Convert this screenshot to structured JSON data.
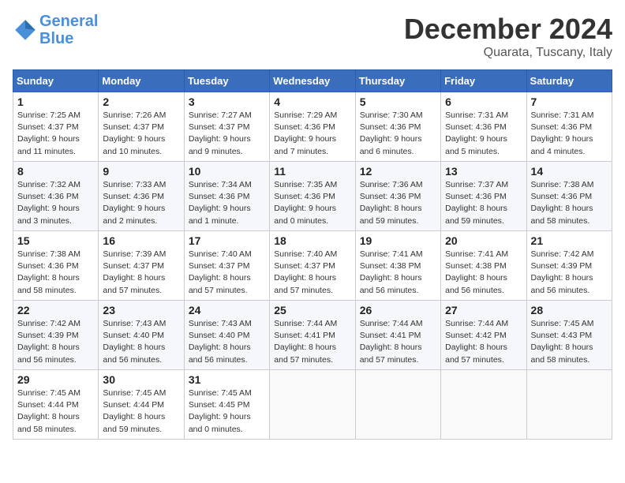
{
  "header": {
    "logo_line1": "General",
    "logo_line2": "Blue",
    "month_title": "December 2024",
    "location": "Quarata, Tuscany, Italy"
  },
  "weekdays": [
    "Sunday",
    "Monday",
    "Tuesday",
    "Wednesday",
    "Thursday",
    "Friday",
    "Saturday"
  ],
  "weeks": [
    [
      {
        "day": "1",
        "sunrise": "7:25 AM",
        "sunset": "4:37 PM",
        "daylight": "9 hours and 11 minutes."
      },
      {
        "day": "2",
        "sunrise": "7:26 AM",
        "sunset": "4:37 PM",
        "daylight": "9 hours and 10 minutes."
      },
      {
        "day": "3",
        "sunrise": "7:27 AM",
        "sunset": "4:37 PM",
        "daylight": "9 hours and 9 minutes."
      },
      {
        "day": "4",
        "sunrise": "7:29 AM",
        "sunset": "4:36 PM",
        "daylight": "9 hours and 7 minutes."
      },
      {
        "day": "5",
        "sunrise": "7:30 AM",
        "sunset": "4:36 PM",
        "daylight": "9 hours and 6 minutes."
      },
      {
        "day": "6",
        "sunrise": "7:31 AM",
        "sunset": "4:36 PM",
        "daylight": "9 hours and 5 minutes."
      },
      {
        "day": "7",
        "sunrise": "7:31 AM",
        "sunset": "4:36 PM",
        "daylight": "9 hours and 4 minutes."
      }
    ],
    [
      {
        "day": "8",
        "sunrise": "7:32 AM",
        "sunset": "4:36 PM",
        "daylight": "9 hours and 3 minutes."
      },
      {
        "day": "9",
        "sunrise": "7:33 AM",
        "sunset": "4:36 PM",
        "daylight": "9 hours and 2 minutes."
      },
      {
        "day": "10",
        "sunrise": "7:34 AM",
        "sunset": "4:36 PM",
        "daylight": "9 hours and 1 minute."
      },
      {
        "day": "11",
        "sunrise": "7:35 AM",
        "sunset": "4:36 PM",
        "daylight": "9 hours and 0 minutes."
      },
      {
        "day": "12",
        "sunrise": "7:36 AM",
        "sunset": "4:36 PM",
        "daylight": "8 hours and 59 minutes."
      },
      {
        "day": "13",
        "sunrise": "7:37 AM",
        "sunset": "4:36 PM",
        "daylight": "8 hours and 59 minutes."
      },
      {
        "day": "14",
        "sunrise": "7:38 AM",
        "sunset": "4:36 PM",
        "daylight": "8 hours and 58 minutes."
      }
    ],
    [
      {
        "day": "15",
        "sunrise": "7:38 AM",
        "sunset": "4:36 PM",
        "daylight": "8 hours and 58 minutes."
      },
      {
        "day": "16",
        "sunrise": "7:39 AM",
        "sunset": "4:37 PM",
        "daylight": "8 hours and 57 minutes."
      },
      {
        "day": "17",
        "sunrise": "7:40 AM",
        "sunset": "4:37 PM",
        "daylight": "8 hours and 57 minutes."
      },
      {
        "day": "18",
        "sunrise": "7:40 AM",
        "sunset": "4:37 PM",
        "daylight": "8 hours and 57 minutes."
      },
      {
        "day": "19",
        "sunrise": "7:41 AM",
        "sunset": "4:38 PM",
        "daylight": "8 hours and 56 minutes."
      },
      {
        "day": "20",
        "sunrise": "7:41 AM",
        "sunset": "4:38 PM",
        "daylight": "8 hours and 56 minutes."
      },
      {
        "day": "21",
        "sunrise": "7:42 AM",
        "sunset": "4:39 PM",
        "daylight": "8 hours and 56 minutes."
      }
    ],
    [
      {
        "day": "22",
        "sunrise": "7:42 AM",
        "sunset": "4:39 PM",
        "daylight": "8 hours and 56 minutes."
      },
      {
        "day": "23",
        "sunrise": "7:43 AM",
        "sunset": "4:40 PM",
        "daylight": "8 hours and 56 minutes."
      },
      {
        "day": "24",
        "sunrise": "7:43 AM",
        "sunset": "4:40 PM",
        "daylight": "8 hours and 56 minutes."
      },
      {
        "day": "25",
        "sunrise": "7:44 AM",
        "sunset": "4:41 PM",
        "daylight": "8 hours and 57 minutes."
      },
      {
        "day": "26",
        "sunrise": "7:44 AM",
        "sunset": "4:41 PM",
        "daylight": "8 hours and 57 minutes."
      },
      {
        "day": "27",
        "sunrise": "7:44 AM",
        "sunset": "4:42 PM",
        "daylight": "8 hours and 57 minutes."
      },
      {
        "day": "28",
        "sunrise": "7:45 AM",
        "sunset": "4:43 PM",
        "daylight": "8 hours and 58 minutes."
      }
    ],
    [
      {
        "day": "29",
        "sunrise": "7:45 AM",
        "sunset": "4:44 PM",
        "daylight": "8 hours and 58 minutes."
      },
      {
        "day": "30",
        "sunrise": "7:45 AM",
        "sunset": "4:44 PM",
        "daylight": "8 hours and 59 minutes."
      },
      {
        "day": "31",
        "sunrise": "7:45 AM",
        "sunset": "4:45 PM",
        "daylight": "9 hours and 0 minutes."
      },
      null,
      null,
      null,
      null
    ]
  ],
  "labels": {
    "sunrise": "Sunrise:",
    "sunset": "Sunset:",
    "daylight": "Daylight:"
  }
}
